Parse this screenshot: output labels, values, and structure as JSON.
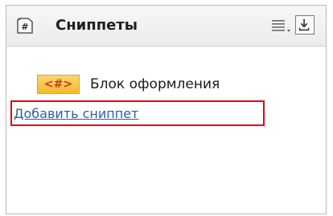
{
  "panel": {
    "title": "Сниппеты",
    "header_icon": "hash-tag-icon",
    "header_icon_glyph": "#",
    "toolbar": {
      "list_icon": "list-menu-icon",
      "download_icon": "download-icon"
    }
  },
  "snippets": [
    {
      "tag": "<#>",
      "label": "Блок оформления"
    }
  ],
  "add_snippet_link": "Добавить сниппет",
  "colors": {
    "highlight_border": "#e30613",
    "tag_bg": "#f4b92d",
    "tag_text": "#c0392b",
    "link": "#2d5ea8"
  }
}
